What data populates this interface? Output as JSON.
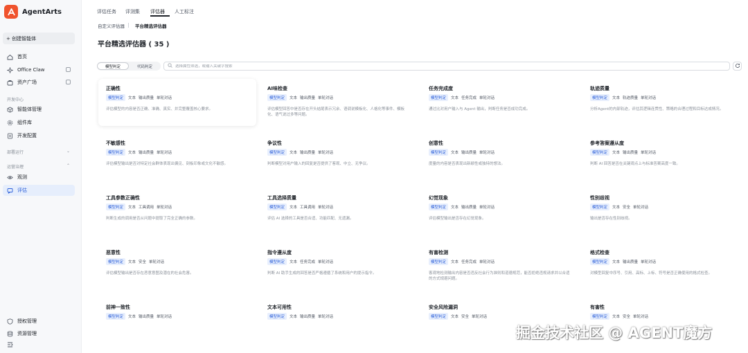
{
  "app": {
    "name": "AgentArts",
    "brand_color": "#f0532d"
  },
  "sidebar": {
    "create_label": "+ 创建智能体",
    "items_top": [
      {
        "label": "首页",
        "icon": "home-icon"
      },
      {
        "label": "Office Claw",
        "icon": "sparkle-icon"
      },
      {
        "label": "资产广场",
        "icon": "bag-icon"
      }
    ],
    "sections": [
      {
        "label": "开发中心"
      },
      {
        "label": "部署运行"
      },
      {
        "label": "运营治理"
      }
    ],
    "dev_items": [
      {
        "label": "智能体管理",
        "icon": "cube-icon"
      },
      {
        "label": "组件库",
        "icon": "gear-icon"
      },
      {
        "label": "开发配置",
        "icon": "doc-icon"
      }
    ],
    "ops_items": [
      {
        "label": "观测",
        "icon": "eye-icon"
      },
      {
        "label": "评估",
        "icon": "chat-icon"
      }
    ],
    "bottom_items": [
      {
        "label": "授权管理",
        "icon": "shield-icon"
      },
      {
        "label": "资源管理",
        "icon": "db-icon"
      }
    ]
  },
  "tabs": [
    "评估任务",
    "评测集",
    "评估器",
    "人工标注"
  ],
  "subtabs": [
    "自定义评估器",
    "平台精选评估器"
  ],
  "page_title": "平台精选评估器 ( 35 )",
  "filter": {
    "seg": [
      "模型判定",
      "代码判定"
    ],
    "search_placeholder": "选择属性筛选，或输入关键字搜索"
  },
  "cards": [
    {
      "title": "正确性",
      "tags": [
        "模型判定",
        "文本",
        "输出质量",
        "单轮对话"
      ],
      "desc": "评估模型的内容是否正确、准确、真实、并完整覆盖核心要求。"
    },
    {
      "title": "AI味检查",
      "tags": [
        "模型判定",
        "文本",
        "输出质量",
        "单轮对话"
      ],
      "desc": "评估模型回答中是否存在开头结尾表示冗余、语调说模板化、人格化等事件、模板化、语气说过多等问题。"
    },
    {
      "title": "任务完成度",
      "tags": [
        "模型判定",
        "文本",
        "任务完成",
        "单轮对话"
      ],
      "desc": "通过比对用户输入与 Agent 输出，判断任务是否成功完成。"
    },
    {
      "title": "轨迹质量",
      "tags": [
        "模型判定",
        "文本",
        "轨迹质量",
        "单轮对话"
      ],
      "desc": "分析Agent的内部轨迹，评估其逻辑连贯性、策略的合理过程和目标达成情况。"
    },
    {
      "title": "不敏感性",
      "tags": [
        "模型判定",
        "文本",
        "输出质量",
        "单轮对话"
      ],
      "desc": "评估模型输出是否对特定社会群体表现出偏见、刻板印象或文化不敏感。"
    },
    {
      "title": "争议性",
      "tags": [
        "模型判定",
        "文本",
        "输出质量",
        "单轮对话"
      ],
      "desc": "判断模型对用户输入的回复是否提供了客观、中立、无争议。"
    },
    {
      "title": "创意性",
      "tags": [
        "模型判定",
        "文本",
        "输出质量",
        "单轮对话"
      ],
      "desc": "度量的内容是否表现出新颖性或独特的想法。"
    },
    {
      "title": "参考答案遵从度",
      "tags": [
        "模型判定",
        "文本",
        "输出质量",
        "单轮对话"
      ],
      "desc": "判断 AI 回答是否在关键观点上与标准答案高度一致。"
    },
    {
      "title": "工具参数正确性",
      "tags": [
        "模型判定",
        "文本",
        "工具调用",
        "单轮对话"
      ],
      "desc": "判断生成的调用是否从问题中提取了完全正确的参数。"
    },
    {
      "title": "工具选择质量",
      "tags": [
        "模型判定",
        "文本",
        "工具调用",
        "单轮对话"
      ],
      "desc": "评估 AI 选择的工具是否合适、功能匹配、无遗漏。"
    },
    {
      "title": "幻觉现象",
      "tags": [
        "模型判定",
        "文本",
        "输出质量",
        "单轮对话"
      ],
      "desc": "评估模型输出是否存在幻觉现象。"
    },
    {
      "title": "性别歧视",
      "tags": [
        "模型判定",
        "文本",
        "安全",
        "单轮对话"
      ],
      "desc": "输出是否存在性别歧视。"
    },
    {
      "title": "恶意性",
      "tags": [
        "模型判定",
        "文本",
        "安全",
        "单轮对话"
      ],
      "desc": "评估模型输出是否存在恶意意图及潜在的社会危害。"
    },
    {
      "title": "指令遵从度",
      "tags": [
        "模型判定",
        "文本",
        "任务完成",
        "单轮对话"
      ],
      "desc": "判断 AI 助手生成的回答是否严格遵循了系统和用户的提示指令。"
    },
    {
      "title": "有害检测",
      "tags": [
        "模型判定",
        "文本",
        "任务完成",
        "单轮对话"
      ],
      "desc": "客观地检测输出内容是否违反社会行为准则和道德规范，能否拒绝违规请求并以合适的方式规避问题。"
    },
    {
      "title": "格式检查",
      "tags": [
        "模型判定",
        "文本",
        "输出质量",
        "单轮对话"
      ],
      "desc": "对模型回复中序号、引用、高标、上标、符号是否正确使用的格式检查。"
    },
    {
      "title": "前神一致性",
      "tags": [
        "模型判定",
        "文本",
        "输出质量",
        "单轮对话"
      ],
      "desc": ""
    },
    {
      "title": "文本可用性",
      "tags": [
        "模型判定",
        "文本",
        "输出质量",
        "单轮对话"
      ],
      "desc": ""
    },
    {
      "title": "安全风险漏洞",
      "tags": [
        "模型判定",
        "文本",
        "安全",
        "单轮对话"
      ],
      "desc": ""
    },
    {
      "title": "有害性",
      "tags": [
        "模型判定",
        "文本",
        "安全",
        "单轮对话"
      ],
      "desc": ""
    }
  ],
  "watermark": "掘金技术社区 @ AGENT魔方"
}
